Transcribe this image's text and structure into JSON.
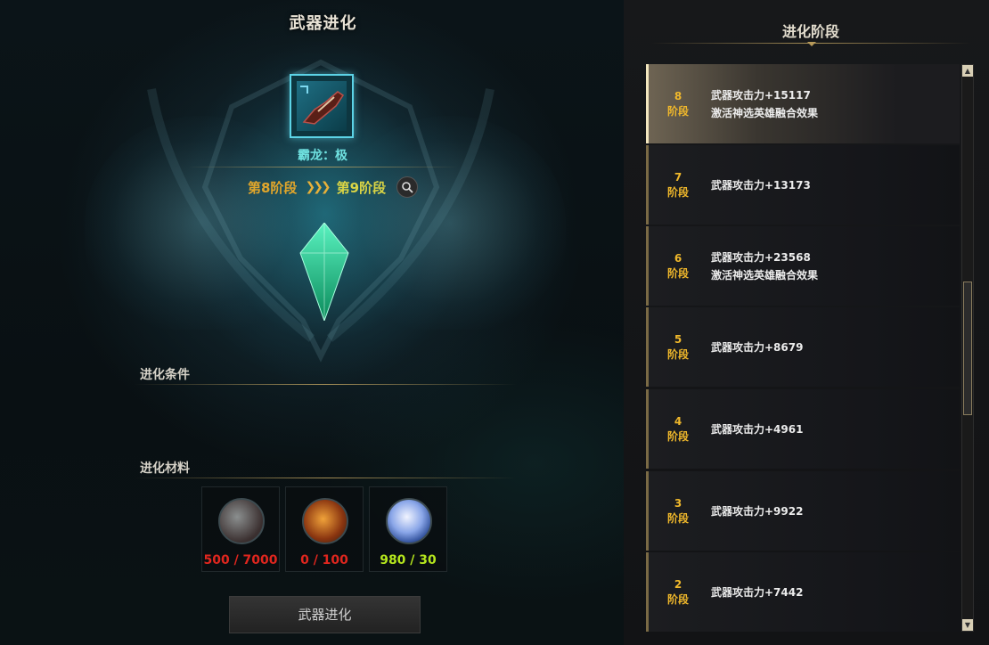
{
  "left": {
    "title": "武器进化",
    "item_name": "霸龙：极",
    "stage_from": "第8阶段",
    "stage_arrows": "❯❯❯",
    "stage_to": "第9阶段",
    "conditions_label": "进化条件",
    "materials_label": "进化材料",
    "materials": [
      {
        "icon": "chest-icon",
        "count": "500 / 7000",
        "color": "#e0261e"
      },
      {
        "icon": "fire-stone-icon",
        "count": "0 / 100",
        "color": "#e0261e"
      },
      {
        "icon": "crystal-icon",
        "count": "980 / 30",
        "color": "#b5e61d"
      }
    ],
    "evolve_button": "武器进化"
  },
  "right": {
    "title": "进化阶段",
    "stages": [
      {
        "num": "8",
        "unit": "阶段",
        "line1": "武器攻击力+15117",
        "line2": "激活神选英雄融合效果",
        "active": true
      },
      {
        "num": "7",
        "unit": "阶段",
        "line1": "武器攻击力+13173",
        "line2": ""
      },
      {
        "num": "6",
        "unit": "阶段",
        "line1": "武器攻击力+23568",
        "line2": "激活神选英雄融合效果"
      },
      {
        "num": "5",
        "unit": "阶段",
        "line1": "武器攻击力+8679",
        "line2": ""
      },
      {
        "num": "4",
        "unit": "阶段",
        "line1": "武器攻击力+4961",
        "line2": ""
      },
      {
        "num": "3",
        "unit": "阶段",
        "line1": "武器攻击力+9922",
        "line2": ""
      },
      {
        "num": "2",
        "unit": "阶段",
        "line1": "武器攻击力+7442",
        "line2": ""
      }
    ],
    "scroll_up_glyph": "▲",
    "scroll_down_glyph": "▼"
  }
}
